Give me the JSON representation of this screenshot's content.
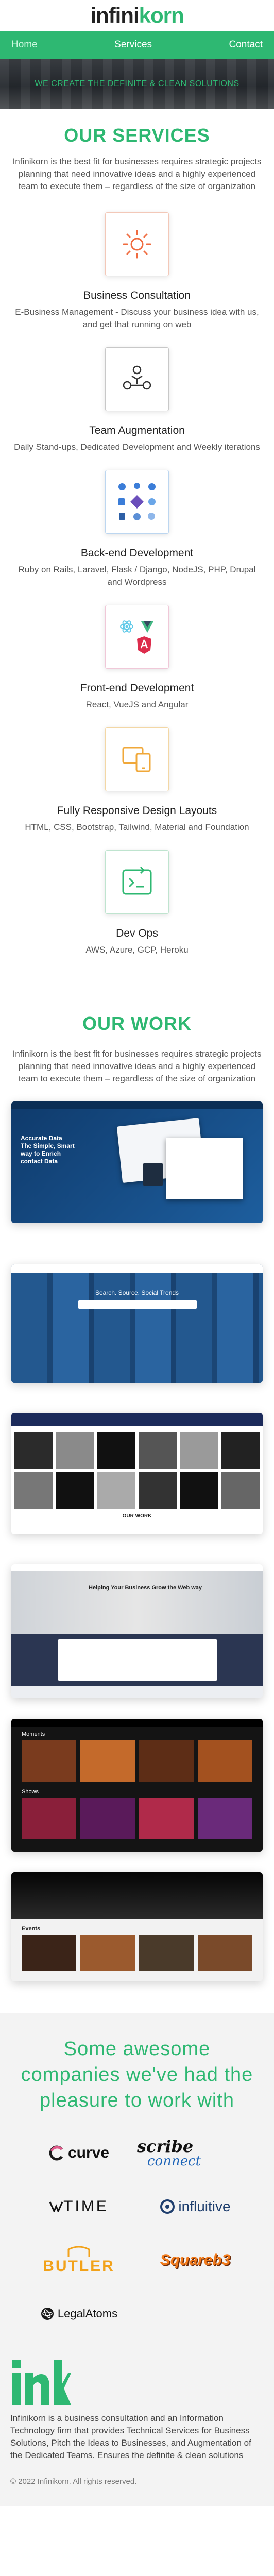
{
  "brand": {
    "name_main": "infini",
    "name_accent": "korn",
    "accent": "#2eb872"
  },
  "nav": {
    "items": [
      "Home",
      "Services",
      "Contact"
    ]
  },
  "hero": {
    "tagline": "WE CREATE THE DEFINITE & CLEAN SOLUTIONS"
  },
  "services": {
    "title": "OUR SERVICES",
    "intro": "Infinikorn is the best fit for businesses requires strategic projects planning that need innovative ideas and a highly experienced team to execute them – regardless of the size of organization",
    "items": [
      {
        "name": "Business Consultation",
        "desc": "E-Business Management - Discuss your business idea with us, and get that running on web",
        "icon": "sun-icon"
      },
      {
        "name": "Team Augmentation",
        "desc": "Daily Stand-ups, Dedicated Development and Weekly iterations",
        "icon": "team-icon"
      },
      {
        "name": "Back-end Development",
        "desc": "Ruby on Rails, Laravel, Flask / Django, NodeJS, PHP, Drupal and Wordpress",
        "icon": "backend-icon"
      },
      {
        "name": "Front-end Development",
        "desc": "React, VueJS and Angular",
        "icon": "frontend-icon"
      },
      {
        "name": "Fully Responsive Design Layouts",
        "desc": "HTML, CSS, Bootstrap, Tailwind, Material and Foundation",
        "icon": "responsive-icon"
      },
      {
        "name": "Dev Ops",
        "desc": "AWS, Azure, GCP, Heroku",
        "icon": "devops-icon"
      }
    ]
  },
  "work": {
    "title": "OUR WORK",
    "intro": "Infinikorn is the best fit for businesses requires strategic projects planning that need innovative ideas and a highly experienced team to execute them – regardless of the size of organization",
    "shots": [
      {
        "lines": [
          "Accurate Data",
          "The Simple, Smart",
          "way to Enrich",
          "contact Data"
        ]
      },
      {
        "lines": [
          "Search. Source. Social Trends"
        ]
      },
      {
        "lines": [
          "OUR WORK"
        ]
      },
      {
        "lines": [
          "Helping Your Business Grow the Web way"
        ]
      },
      {
        "lines": [
          "Moments",
          "Shows"
        ]
      },
      {
        "lines": [
          "Events"
        ]
      }
    ]
  },
  "companies": {
    "title": "Some awesome companies we've had the pleasure to work with",
    "logos": [
      {
        "name": "curve",
        "icon": "curve-logo"
      },
      {
        "name": "scribe connect",
        "icon": "scribe-logo",
        "top": "scribe",
        "bottom": "connect"
      },
      {
        "name": "TIME",
        "icon": "time-logo"
      },
      {
        "name": "influitive",
        "icon": "influitive-logo"
      },
      {
        "name": "BUTLER",
        "icon": "butler-logo"
      },
      {
        "name": "Squareb3",
        "icon": "squareb3-logo"
      },
      {
        "name": "LegalAtoms",
        "icon": "legalatoms-logo"
      }
    ]
  },
  "footer": {
    "logo": "ink",
    "text": "Infinikorn is a business consultation and an Information Technology firm that provides Technical Services for Business Solutions, Pitch the Ideas to Businesses, and Augmentation of the Dedicated Teams. Ensures the definite & clean solutions",
    "copyright": "© 2022 Infinikorn. All rights reserved."
  }
}
